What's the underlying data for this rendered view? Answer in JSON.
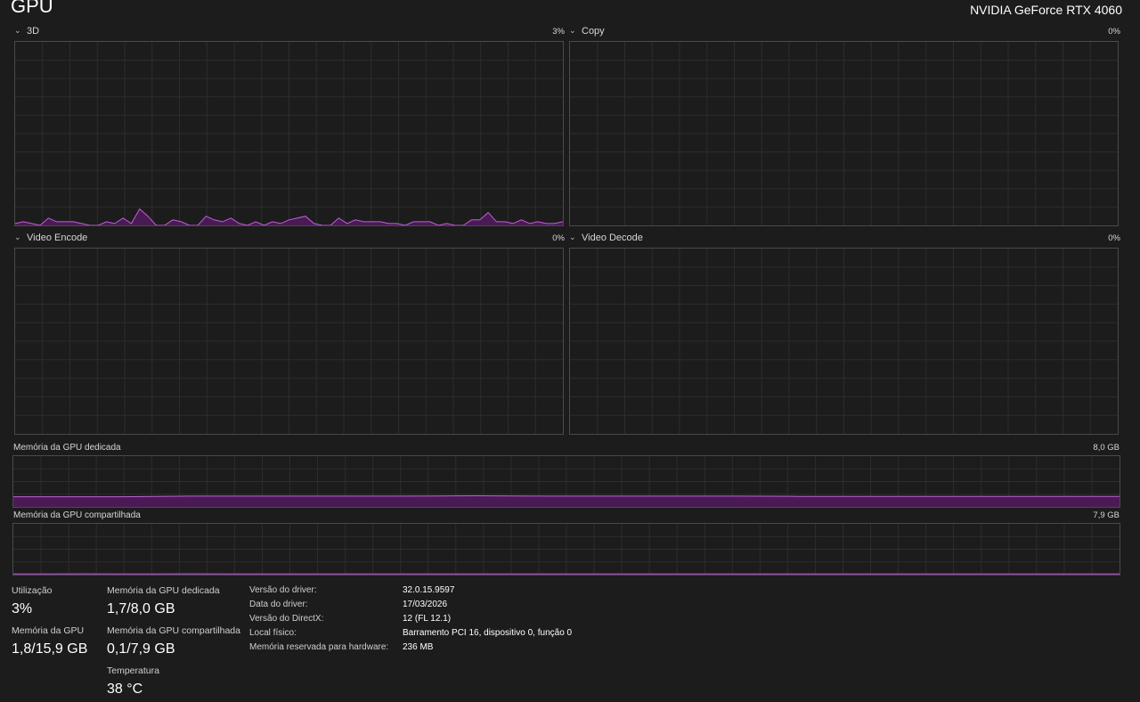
{
  "header": {
    "title": "GPU",
    "device_name": "NVIDIA GeForce RTX 4060"
  },
  "engines": [
    {
      "label": "3D",
      "percent": "3%"
    },
    {
      "label": "Copy",
      "percent": "0%"
    },
    {
      "label": "Video Encode",
      "percent": "0%"
    },
    {
      "label": "Video Decode",
      "percent": "0%"
    }
  ],
  "memory_graphs": {
    "dedicated": {
      "label": "Memória da GPU dedicada",
      "max": "8,0 GB"
    },
    "shared": {
      "label": "Memória da GPU compartilhada",
      "max": "7,9 GB"
    }
  },
  "stats": {
    "utilization": {
      "label": "Utilização",
      "value": "3%"
    },
    "gpu_memory": {
      "label": "Memória da GPU",
      "value": "1,8/15,9 GB"
    },
    "dedicated_memory": {
      "label": "Memória da GPU dedicada",
      "value": "1,7/8,0 GB"
    },
    "shared_memory": {
      "label": "Memória da GPU compartilhada",
      "value": "0,1/7,9 GB"
    },
    "temperature": {
      "label": "Temperatura",
      "value": "38 °C"
    }
  },
  "details": [
    {
      "label": "Versão do driver:",
      "value": "32.0.15.9597"
    },
    {
      "label": "Data do driver:",
      "value": "17/03/2026"
    },
    {
      "label": "Versão do DirectX:",
      "value": "12 (FL 12.1)"
    },
    {
      "label": "Local físico:",
      "value": "Barramento PCI 16, dispositivo 0, função 0"
    },
    {
      "label": "Memória reservada para hardware:",
      "value": "236 MB"
    }
  ],
  "colors": {
    "accent_line": "#c060d8",
    "accent_fill": "#4a1a55",
    "grid": "#2d2d2d",
    "border": "#4a4a4a"
  },
  "chart_data": [
    {
      "type": "area",
      "engine": "3D",
      "ylim": [
        0,
        100
      ],
      "values": [
        1,
        2,
        1,
        0,
        4,
        2,
        2,
        2,
        1,
        0,
        0,
        2,
        1,
        4,
        1,
        9,
        5,
        0,
        0,
        3,
        2,
        0,
        0,
        5,
        3,
        2,
        4,
        1,
        0,
        2,
        0,
        2,
        1,
        3,
        4,
        5,
        1,
        0,
        0,
        4,
        1,
        3,
        2,
        2,
        2,
        1,
        1,
        0,
        2,
        2,
        2,
        0,
        1,
        0,
        0,
        3,
        3,
        7,
        2,
        2,
        1,
        3,
        1,
        2,
        1,
        1,
        2
      ]
    },
    {
      "type": "area",
      "engine": "Copy",
      "ylim": [
        0,
        100
      ],
      "values": []
    },
    {
      "type": "area",
      "engine": "Video Encode",
      "ylim": [
        0,
        100
      ],
      "values": []
    },
    {
      "type": "area",
      "engine": "Video Decode",
      "ylim": [
        0,
        100
      ],
      "values": []
    },
    {
      "type": "area",
      "series_name": "Memória da GPU dedicada",
      "unit": "GB",
      "ylim": [
        0,
        8.0
      ],
      "values": [
        1.6,
        1.6,
        1.6,
        1.6,
        1.65,
        1.7,
        1.7,
        1.7,
        1.7,
        1.7,
        1.7,
        1.7,
        1.72,
        1.75,
        1.72,
        1.7,
        1.7,
        1.7,
        1.7,
        1.7,
        1.7,
        1.68,
        1.66,
        1.65,
        1.65,
        1.65,
        1.65,
        1.65,
        1.65,
        1.65,
        1.65,
        1.65
      ]
    },
    {
      "type": "area",
      "series_name": "Memória da GPU compartilhada",
      "unit": "GB",
      "ylim": [
        0,
        7.9
      ],
      "values": [
        0.1,
        0.1,
        0.12,
        0.1,
        0.1,
        0.12,
        0.1,
        0.1,
        0.1,
        0.1,
        0.1,
        0.1,
        0.1,
        0.1,
        0.1,
        0.1,
        0.1,
        0.1,
        0.1,
        0.1,
        0.1,
        0.1,
        0.1,
        0.1,
        0.1,
        0.1,
        0.1,
        0.1,
        0.1,
        0.1,
        0.1,
        0.1
      ]
    }
  ]
}
